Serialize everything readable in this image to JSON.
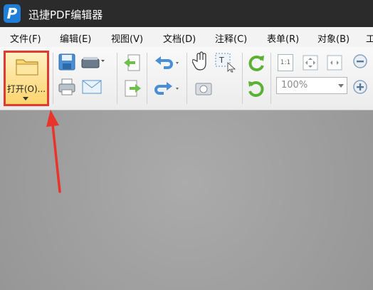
{
  "app": {
    "title": "迅捷PDF编辑器",
    "logo_letter": "P"
  },
  "menu": [
    "文件(F)",
    "编辑(E)",
    "视图(V)",
    "文档(D)",
    "注释(C)",
    "表单(R)",
    "对象(B)",
    "工"
  ],
  "toolbar": {
    "open_label": "打开(O)...",
    "zoom_value": "100%",
    "page_fit_label": "1:1"
  },
  "colors": {
    "highlight": "#e23a2e",
    "titlebar": "#2b2b2b",
    "accent": "#1f7fd8"
  }
}
